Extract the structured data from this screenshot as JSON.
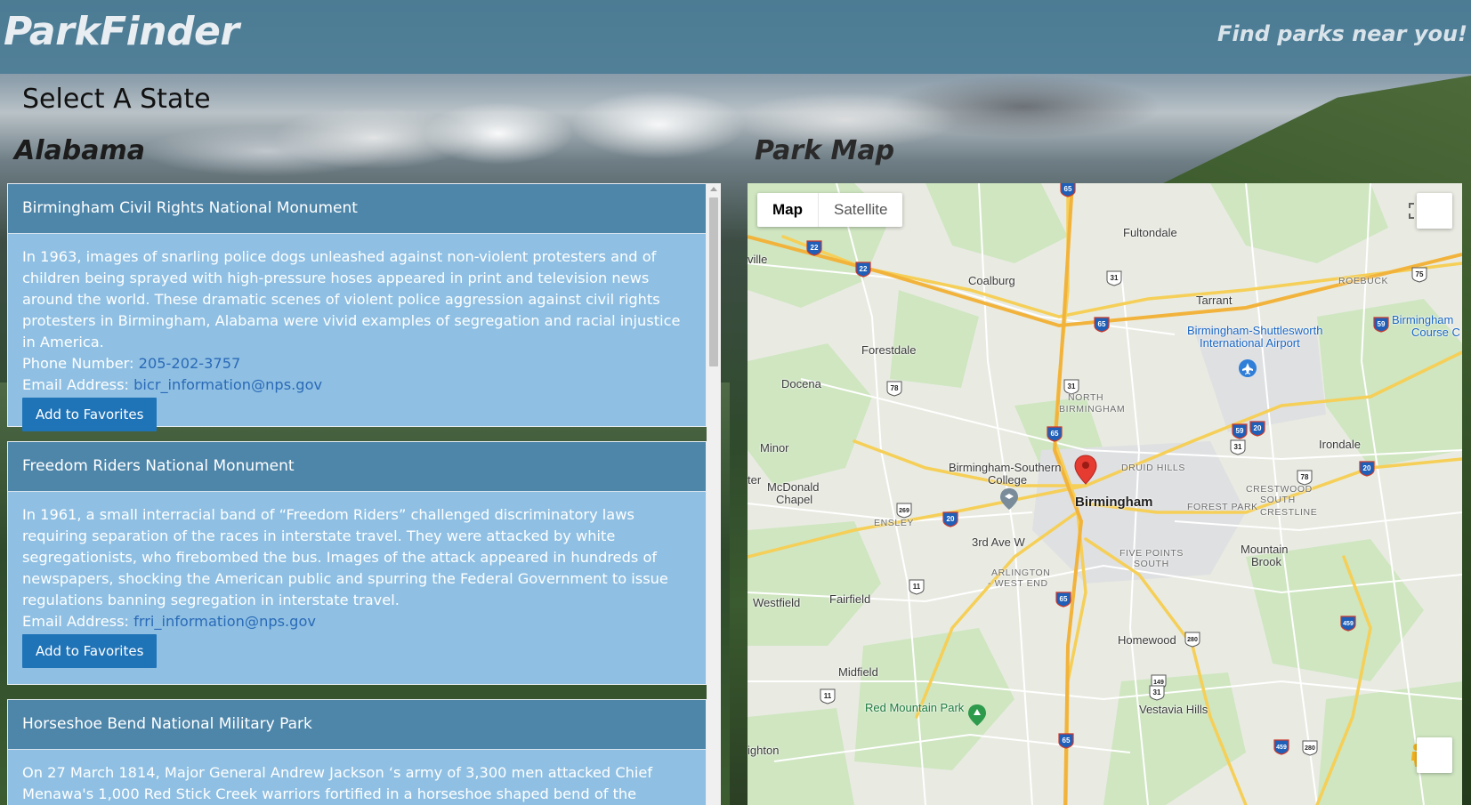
{
  "header": {
    "brand": "ParkFinder",
    "tagline": "Find parks near you!"
  },
  "select_state_label": "Select A State",
  "state_name": "Alabama",
  "map_title": "Park Map",
  "parks": [
    {
      "name": "Birmingham Civil Rights National Monument",
      "description": "In 1963, images of snarling police dogs unleashed against non-violent protesters and of children being sprayed with high-pressure hoses appeared in print and television news around the world. These dramatic scenes of violent police aggression against civil rights protesters in Birmingham, Alabama were vivid examples of segregation and racial injustice in America.",
      "phone_label": "Phone Number:",
      "phone": "205-202-3757",
      "email_label": "Email Address:",
      "email": "bicr_information@nps.gov",
      "button": "Add to Favorites"
    },
    {
      "name": "Freedom Riders National Monument",
      "description": "In 1961, a small interracial band of “Freedom Riders” challenged discriminatory laws requiring separation of the races in interstate travel. They were attacked by white segregationists, who firebombed the bus. Images of the attack appeared in hundreds of newspapers, shocking the American public and spurring the Federal Government to issue regulations banning segregation in interstate travel.",
      "email_label": "Email Address:",
      "email": "frri_information@nps.gov",
      "button": "Add to Favorites"
    },
    {
      "name": "Horseshoe Bend National Military Park",
      "description": "On 27 March 1814, Major General Andrew Jackson ‘s army of 3,300 men attacked Chief Menawa's 1,000 Red Stick Creek warriors fortified in a horseshoe shaped bend of the"
    }
  ],
  "map": {
    "toggle_map": "Map",
    "toggle_satellite": "Satellite",
    "labels": {
      "fultondale": "Fultondale",
      "coalburg": "Coalburg",
      "tarrant": "Tarrant",
      "roebuck": "ROEBUCK",
      "airport": "Birmingham-Shuttlesworth International Airport",
      "airport_line1": "Birmingham-Shuttlesworth",
      "airport_line2": "International Airport",
      "birmingham_course": "Birmingham",
      "course": "Course C",
      "forestdale": "Forestdale",
      "docena": "Docena",
      "north_birmingham_1": "NORTH",
      "north_birmingham_2": "BIRMINGHAM",
      "minor": "Minor",
      "irondale": "Irondale",
      "druid_hills": "DRUID HILLS",
      "bsc_1": "Birmingham-Southern",
      "bsc_2": "College",
      "mcdonald_1": "McDonald",
      "mcdonald_2": "Chapel",
      "birmingham": "Birmingham",
      "crestwood_1": "CRESTWOOD",
      "crestwood_2": "SOUTH",
      "forest_park": "FOREST PARK",
      "crestline": "CRESTLINE",
      "ensley": "ENSLEY",
      "third_ave": "3rd Ave W",
      "five_points_1": "FIVE POINTS",
      "five_points_2": "SOUTH",
      "mountain_brook_1": "Mountain",
      "mountain_brook_2": "Brook",
      "arlington_1": "ARLINGTON",
      "arlington_2": "- WEST END",
      "westfield": "Westfield",
      "fairfield": "Fairfield",
      "homewood": "Homewood",
      "midfield": "Midfield",
      "red_mountain": "Red Mountain Park",
      "vestavia": "Vestavia Hills",
      "ville": "ville",
      "ter": "ter",
      "ighton": "ighton"
    },
    "shields": [
      "65",
      "22",
      "22",
      "31",
      "75",
      "65",
      "59",
      "31",
      "78",
      "65",
      "59",
      "20",
      "31",
      "78",
      "20",
      "20",
      "269",
      "78",
      "11",
      "65",
      "459",
      "280",
      "149",
      "31",
      "11",
      "65",
      "459",
      "280"
    ]
  }
}
